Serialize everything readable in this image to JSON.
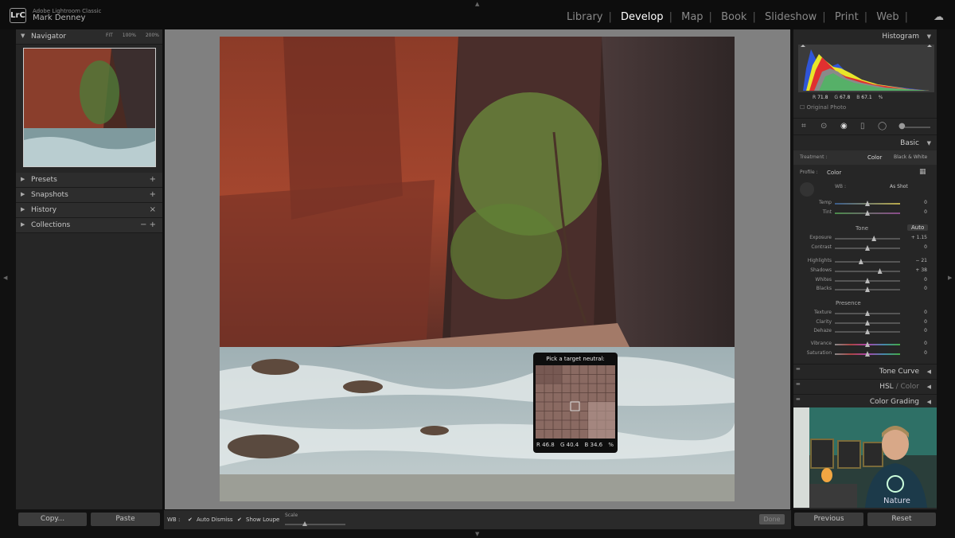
{
  "app": {
    "logo": "LrC",
    "name": "Adobe Lightroom Classic",
    "user": "Mark Denney"
  },
  "modules": [
    {
      "label": "Library",
      "active": false
    },
    {
      "label": "Develop",
      "active": true
    },
    {
      "label": "Map",
      "active": false
    },
    {
      "label": "Book",
      "active": false
    },
    {
      "label": "Slideshow",
      "active": false
    },
    {
      "label": "Print",
      "active": false
    },
    {
      "label": "Web",
      "active": false
    }
  ],
  "left_panel": {
    "navigator": {
      "title": "Navigator",
      "zoom_options": [
        "FIT",
        "100%",
        "200%"
      ]
    },
    "sections": [
      {
        "label": "Presets",
        "action": "+"
      },
      {
        "label": "Snapshots",
        "action": "+"
      },
      {
        "label": "History",
        "action": "×"
      },
      {
        "label": "Collections",
        "action": "− +"
      }
    ],
    "copy_label": "Copy...",
    "paste_label": "Paste"
  },
  "toolbar": {
    "wb_label": "WB :",
    "auto_dismiss": "Auto Dismiss",
    "show_loupe": "Show Loupe",
    "scale_label": "Scale",
    "done_label": "Done"
  },
  "loupe": {
    "title": "Pick a target neutral:",
    "r_label": "R",
    "r": "46.8",
    "g_label": "G",
    "g": "40.4",
    "b_label": "B",
    "b": "34.6",
    "unit": "%"
  },
  "right_panel": {
    "histogram": {
      "title": "Histogram",
      "r_label": "R",
      "r": "71.8",
      "g_label": "G",
      "g": "67.8",
      "b_label": "B",
      "b": "67.1",
      "unit": "%",
      "original_photo": "Original Photo"
    },
    "basic": {
      "title": "Basic",
      "treatment_label": "Treatment :",
      "treatment_color": "Color",
      "treatment_bw": "Black & White",
      "profile_label": "Profile :",
      "profile_value": "Color",
      "wb_label": "WB :",
      "wb_value": "As Shot",
      "tone_label": "Tone",
      "auto_label": "Auto",
      "presence_label": "Presence",
      "sliders": [
        {
          "label": "Temp",
          "value": "0",
          "pos": 0.5
        },
        {
          "label": "Tint",
          "value": "0",
          "pos": 0.5
        },
        {
          "label": "Exposure",
          "value": "+ 1.15",
          "pos": 0.6
        },
        {
          "label": "Contrast",
          "value": "0",
          "pos": 0.5
        },
        {
          "label": "Highlights",
          "value": "− 21",
          "pos": 0.4
        },
        {
          "label": "Shadows",
          "value": "+ 38",
          "pos": 0.69
        },
        {
          "label": "Whites",
          "value": "0",
          "pos": 0.5
        },
        {
          "label": "Blacks",
          "value": "0",
          "pos": 0.5
        },
        {
          "label": "Texture",
          "value": "0",
          "pos": 0.5
        },
        {
          "label": "Clarity",
          "value": "0",
          "pos": 0.5
        },
        {
          "label": "Dehaze",
          "value": "0",
          "pos": 0.5
        },
        {
          "label": "Vibrance",
          "value": "0",
          "pos": 0.5
        },
        {
          "label": "Saturation",
          "value": "0",
          "pos": 0.5
        }
      ]
    },
    "tone_curve": "Tone Curve",
    "hsl": "HSL",
    "hsl_sep": "/",
    "hsl_color": "Color",
    "color_grading": "Color Grading",
    "previous_label": "Previous",
    "reset_label": "Reset"
  },
  "webcam": {
    "shirt_text": "Nature"
  }
}
